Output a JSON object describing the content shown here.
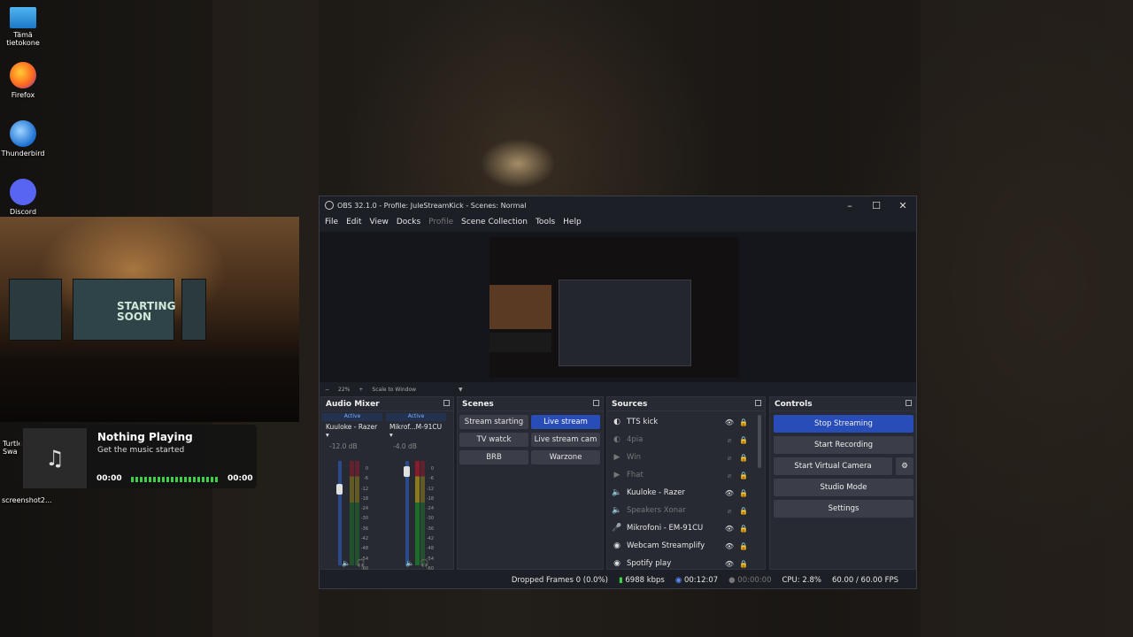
{
  "desktop": {
    "icons": [
      {
        "label": "Tämä\ntietokone",
        "icon": "computer-icon"
      },
      {
        "label": "Firefox",
        "icon": "firefox-icon"
      },
      {
        "label": "Thunderbird",
        "icon": "thunderbird-icon"
      },
      {
        "label": "Discord",
        "icon": "discord-icon"
      },
      {
        "label": "Turtle\nSwa",
        "icon": "app-icon"
      },
      {
        "label": "screenshot2...",
        "icon": "file-icon"
      }
    ]
  },
  "webcam": {
    "sign": "STARTING\nSOON"
  },
  "music": {
    "title": "Nothing Playing",
    "subtitle": "Get the music started",
    "time_current": "00:00",
    "time_total": "00:00",
    "icon": "music-note-icon"
  },
  "obs": {
    "title": "OBS 32.1.0 - Profile: JuleStreamKick - Scenes: Normal",
    "menu": [
      "File",
      "Edit",
      "View",
      "Docks",
      "Profile",
      "Scene Collection",
      "Tools",
      "Help"
    ],
    "zoom": {
      "minus": "−",
      "value": "22%",
      "plus": "+",
      "scale_mode": "Scale to Window"
    },
    "audio_mixer": {
      "title": "Audio Mixer",
      "channels": [
        {
          "active": "Active",
          "name": "Kuuloke - Razer",
          "db": "-12.0 dB"
        },
        {
          "active": "Active",
          "name": "Mikrof...M-91CU",
          "db": "-4.0 dB"
        }
      ],
      "scale": [
        "0",
        "-6",
        "-12",
        "-18",
        "-24",
        "-30",
        "-36",
        "-42",
        "-48",
        "-54",
        "-60"
      ]
    },
    "scenes": {
      "title": "Scenes",
      "items": [
        "Stream starting",
        "Live stream",
        "TV watck",
        "Live stream cam",
        "BRB",
        "Warzone"
      ],
      "selected": "Live stream"
    },
    "sources": {
      "title": "Sources",
      "items": [
        {
          "name": "TTS kick",
          "icon": "browser-icon",
          "visible": true,
          "locked": true
        },
        {
          "name": "4pia",
          "icon": "browser-icon",
          "visible": false,
          "locked": true
        },
        {
          "name": "Win",
          "icon": "play-icon",
          "visible": false,
          "locked": true
        },
        {
          "name": "Fhat",
          "icon": "play-icon",
          "visible": false,
          "locked": true
        },
        {
          "name": "Kuuloke - Razer",
          "icon": "speaker-icon",
          "visible": true,
          "locked": true
        },
        {
          "name": "Speakers Xonar",
          "icon": "speaker-icon",
          "visible": false,
          "locked": true
        },
        {
          "name": "Mikrofoni - EM-91CU",
          "icon": "mic-icon",
          "visible": true,
          "locked": true
        },
        {
          "name": "Webcam Streamplify",
          "icon": "camera-icon",
          "visible": true,
          "locked": false
        },
        {
          "name": "Spotify play",
          "icon": "camera-icon",
          "visible": true,
          "locked": false
        }
      ]
    },
    "controls": {
      "title": "Controls",
      "stop_streaming": "Stop Streaming",
      "start_recording": "Start Recording",
      "start_virtual_camera": "Start Virtual Camera",
      "studio_mode": "Studio Mode",
      "settings": "Settings"
    },
    "status": {
      "dropped_frames": "Dropped Frames 0 (0.0%)",
      "bitrate": "6988 kbps",
      "stream_time": "00:12:07",
      "record_time": "00:00:00",
      "cpu": "CPU: 2.8%",
      "fps": "60.00 / 60.00 FPS"
    },
    "colors": {
      "accent": "#284cb8",
      "panel": "#272a33",
      "window": "#1d1f26"
    }
  }
}
